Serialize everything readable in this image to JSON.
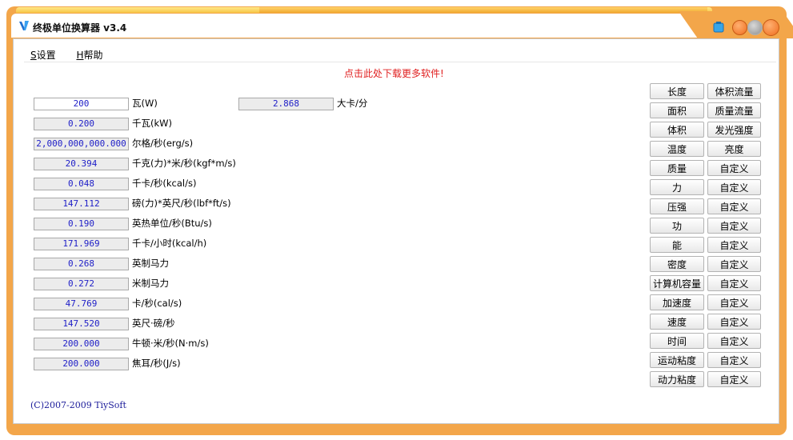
{
  "window": {
    "title": "终极单位换算器 v3.4"
  },
  "colors": {
    "frame": "#f3a64a",
    "value_text": "#2020c8",
    "link": "#e02020"
  },
  "menu": [
    {
      "key": "S",
      "label": "设置"
    },
    {
      "key": "H",
      "label": "帮助"
    }
  ],
  "download_link": "点击此处下载更多软件!",
  "rows": [
    {
      "value": "200",
      "unit": "瓦(W)"
    },
    {
      "value": "0.200",
      "unit": "千瓦(kW)"
    },
    {
      "value": "2,000,000,000.000",
      "unit": "尔格/秒(erg/s)"
    },
    {
      "value": "20.394",
      "unit": "千克(力)*米/秒(kgf*m/s)"
    },
    {
      "value": "0.048",
      "unit": "千卡/秒(kcal/s)"
    },
    {
      "value": "147.112",
      "unit": "磅(力)*英尺/秒(lbf*ft/s)"
    },
    {
      "value": "0.190",
      "unit": "英热单位/秒(Btu/s)"
    },
    {
      "value": "171.969",
      "unit": "千卡/小时(kcal/h)"
    },
    {
      "value": "0.268",
      "unit": "英制马力"
    },
    {
      "value": "0.272",
      "unit": "米制马力"
    },
    {
      "value": "47.769",
      "unit": "卡/秒(cal/s)"
    },
    {
      "value": "147.520",
      "unit": "英尺·磅/秒"
    },
    {
      "value": "200.000",
      "unit": "牛顿·米/秒(N·m/s)"
    },
    {
      "value": "200.000",
      "unit": "焦耳/秒(J/s)"
    }
  ],
  "extra": {
    "value": "2.868",
    "unit": "大卡/分"
  },
  "categories_left": [
    "长度",
    "面积",
    "体积",
    "温度",
    "质量",
    "力",
    "压强",
    "功",
    "能",
    "密度",
    "计算机容量",
    "加速度",
    "速度",
    "时间",
    "运动粘度",
    "动力粘度"
  ],
  "categories_right": [
    "体积流量",
    "质量流量",
    "发光强度",
    "亮度",
    "自定义",
    "自定义",
    "自定义",
    "自定义",
    "自定义",
    "自定义",
    "自定义",
    "自定义",
    "自定义",
    "自定义",
    "自定义",
    "自定义"
  ],
  "copyright": "(C)2007-2009 TiySoft"
}
